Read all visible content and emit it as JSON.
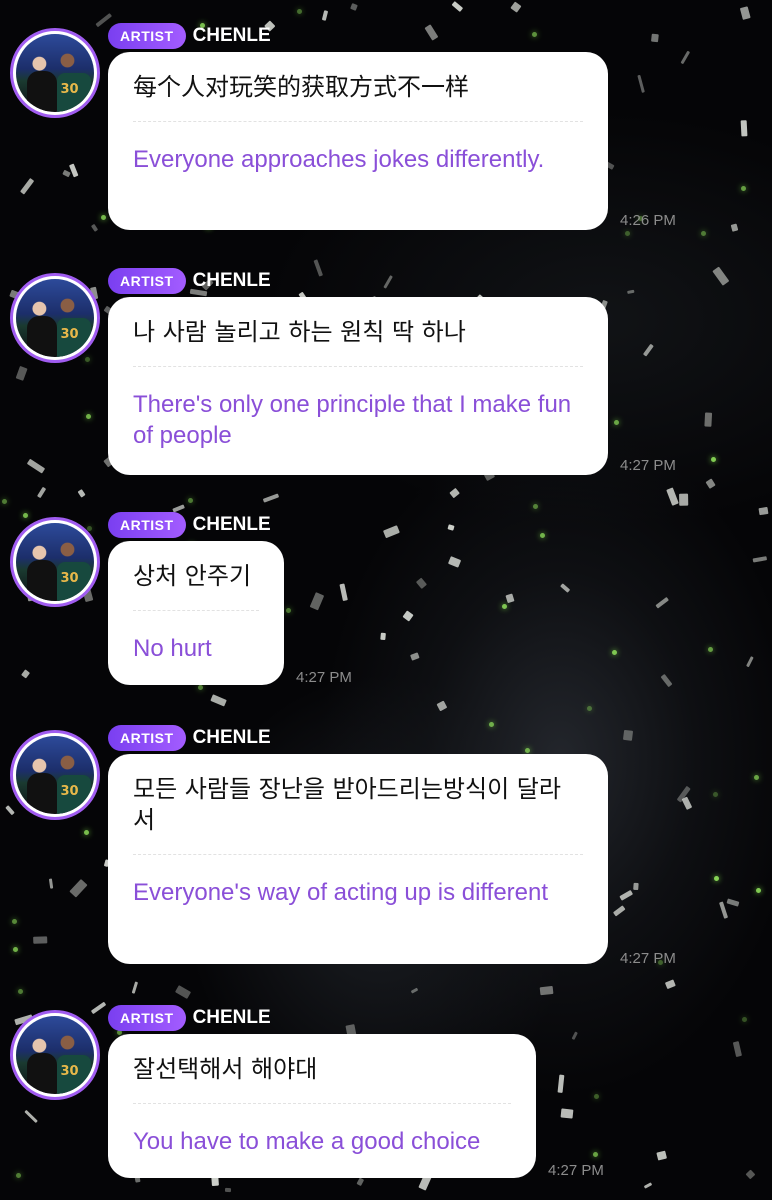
{
  "messages": [
    {
      "badge": "ARTIST",
      "name": "CHENLE",
      "original": "每个人对玩笑的获取方式不一样",
      "translation": "Everyone approaches jokes differently.",
      "time": "4:26 PM"
    },
    {
      "badge": "ARTIST",
      "name": "CHENLE",
      "original": "나 사람 놀리고 하는 원칙 딱 하나",
      "translation": "There's only one principle that I make fun of people",
      "time": "4:27 PM"
    },
    {
      "badge": "ARTIST",
      "name": "CHENLE",
      "original": "상처 안주기",
      "translation": "No hurt",
      "time": "4:27 PM"
    },
    {
      "badge": "ARTIST",
      "name": "CHENLE",
      "original": "모든 사람들 장난을 받아드리는방식이 달라서",
      "translation": "Everyone's way of acting up is different",
      "time": "4:27 PM"
    },
    {
      "badge": "ARTIST",
      "name": "CHENLE",
      "original": "잘선택해서 해야대",
      "translation": "You have to make a good choice",
      "time": "4:27 PM"
    }
  ],
  "colors": {
    "badge": "#8b4cf5",
    "avatar_ring": "#a05cf0",
    "translation_text": "#8a4fd8",
    "timestamp": "#8c8c8c"
  }
}
